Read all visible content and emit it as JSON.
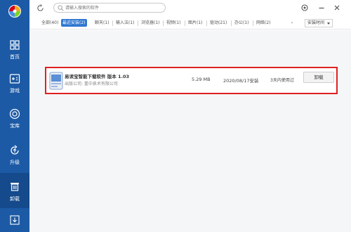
{
  "sidebar": {
    "items": [
      {
        "label": "首页",
        "icon": "home-icon"
      },
      {
        "label": "游戏",
        "icon": "gamepad-icon"
      },
      {
        "label": "宝库",
        "icon": "treasure-icon"
      },
      {
        "label": "升级",
        "icon": "upgrade-icon"
      },
      {
        "label": "卸载",
        "icon": "trash-icon"
      }
    ],
    "bottom_icon": "download-icon"
  },
  "header": {
    "search_placeholder": "请输入搜索的软件"
  },
  "tabs": [
    {
      "label": "全部(40)"
    },
    {
      "label": "最近安装(2)"
    },
    {
      "label": "聊天(1)"
    },
    {
      "label": "输入法(1)"
    },
    {
      "label": "浏览器(1)"
    },
    {
      "label": "视频(1)"
    },
    {
      "label": "图片(1)"
    },
    {
      "label": "驱动(21)"
    },
    {
      "label": "办公(1)"
    },
    {
      "label": "网络(2)"
    }
  ],
  "sort": {
    "label": "安装时间"
  },
  "apps": [
    {
      "name": "易读宝智能下载软件 版本 1.03",
      "publisher": "出版公司: 重中泉术有限公司",
      "size": "5.29 MB",
      "date": "2020/08/17安装",
      "usage": "3天内使用过",
      "action": "卸载"
    }
  ],
  "colors": {
    "sidebar": "#1c5aa6",
    "accent": "#2f77d1",
    "highlight_border": "#e02020"
  }
}
